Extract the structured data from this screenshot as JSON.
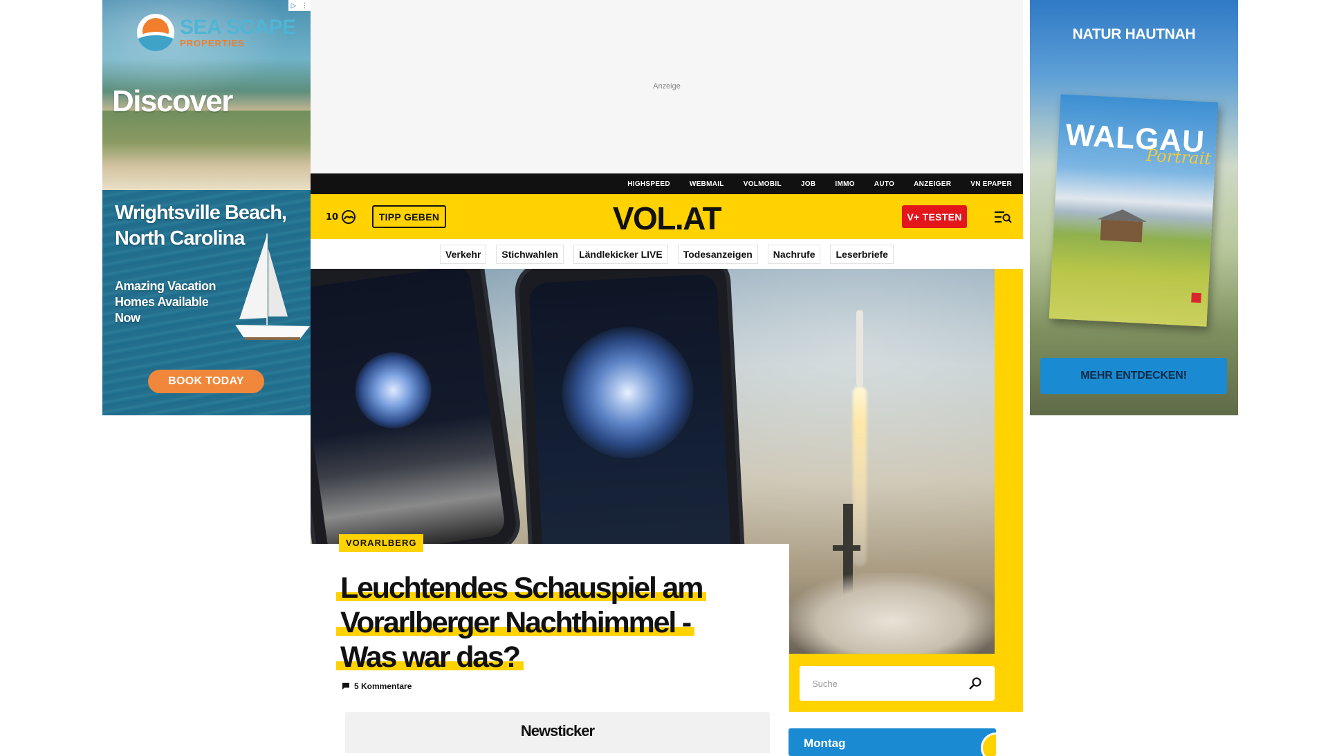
{
  "ads": {
    "left": {
      "logo_line1": "SEA SCAPE",
      "logo_line2": "PROPERTIES",
      "headline": "Discover",
      "place": "Wrightsville Beach, North Carolina",
      "tagline": "Amazing Vacation Homes Available Now",
      "cta": "BOOK TODAY",
      "adchoices_icons": [
        "adchoices-triangle-icon",
        "more-vert-icon"
      ]
    },
    "top": {
      "label": "Anzeige"
    },
    "right": {
      "title": "NATUR HAUTNAH",
      "magazine_title": "WALGAU",
      "magazine_subtitle": "Portrait",
      "cta": "MEHR ENTDECKEN!"
    }
  },
  "topnav": [
    "HIGHSPEED",
    "WEBMAIL",
    "VOLMOBIL",
    "JOB",
    "IMMO",
    "AUTO",
    "ANZEIGER",
    "VN EPAPER"
  ],
  "header": {
    "temperature": "10",
    "weather_icon": "cloud-sun-icon",
    "tipp_label": "TIPP GEBEN",
    "brand": "VOL.AT",
    "vplus_label": "V+ TESTEN",
    "menu_icon": "menu-search-icon",
    "brand_color": "#ffd200",
    "accent_red": "#e3161b"
  },
  "subnav": [
    "Verkehr",
    "Stichwahlen",
    "Ländlekicker LIVE",
    "Todesanzeigen",
    "Nachrufe",
    "Leserbriefe"
  ],
  "article": {
    "category": "VORARLBERG",
    "headline_lines": [
      "Leuchtendes Schauspiel am",
      "Vorarlberger Nachthimmel -",
      "Was war das?"
    ],
    "comments": "5 Kommentare",
    "comment_icon": "comment-icon"
  },
  "search": {
    "placeholder": "Suche",
    "icon": "search-icon"
  },
  "newsticker": {
    "title": "Newsticker"
  },
  "weather_widget": {
    "day": "Montag"
  }
}
